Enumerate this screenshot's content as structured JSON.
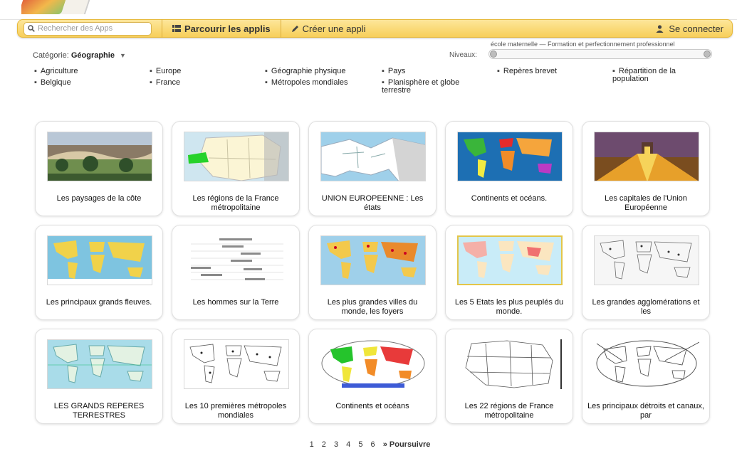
{
  "nav": {
    "search_placeholder": "Rechercher des Apps",
    "browse_label": "Parcourir les applis",
    "create_label": "Créer une appli",
    "login_label": "Se connecter"
  },
  "filters": {
    "category_prefix": "Catégorie:",
    "category_value": "Géographie",
    "level_label": "Niveaux:",
    "level_caption": "école maternelle — Formation et perfectionnement professionnel",
    "level_range": [
      0,
      1
    ]
  },
  "tags": [
    "Agriculture",
    "Belgique",
    "Europe",
    "France",
    "Géographie physique",
    "Métropoles mondiales",
    "Pays",
    "Planisphère et globe terrestre",
    "Repères brevet",
    "Répartition de la population"
  ],
  "apps": [
    {
      "title": "Les paysages de la côte"
    },
    {
      "title": "Les régions de la France métropolitaine"
    },
    {
      "title": "UNION EUROPEENNE : Les états"
    },
    {
      "title": "Continents et océans."
    },
    {
      "title": "Les capitales de l'Union Européenne"
    },
    {
      "title": "Les principaux grands fleuves."
    },
    {
      "title": "Les hommes sur la Terre"
    },
    {
      "title": "Les plus grandes villes du monde, les foyers"
    },
    {
      "title": "Les 5 Etats les plus peuplés du monde."
    },
    {
      "title": "Les grandes agglomérations et les"
    },
    {
      "title": "LES GRANDS REPERES TERRESTRES"
    },
    {
      "title": "Les 10 premières métropoles mondiales"
    },
    {
      "title": "Continents et océans"
    },
    {
      "title": "Les 22 régions de France métropolitaine"
    },
    {
      "title": "Les principaux détroits et canaux, par"
    }
  ],
  "pagination": {
    "pages": [
      "1",
      "2",
      "3",
      "4",
      "5",
      "6"
    ],
    "next_label": "» Poursuivre"
  }
}
